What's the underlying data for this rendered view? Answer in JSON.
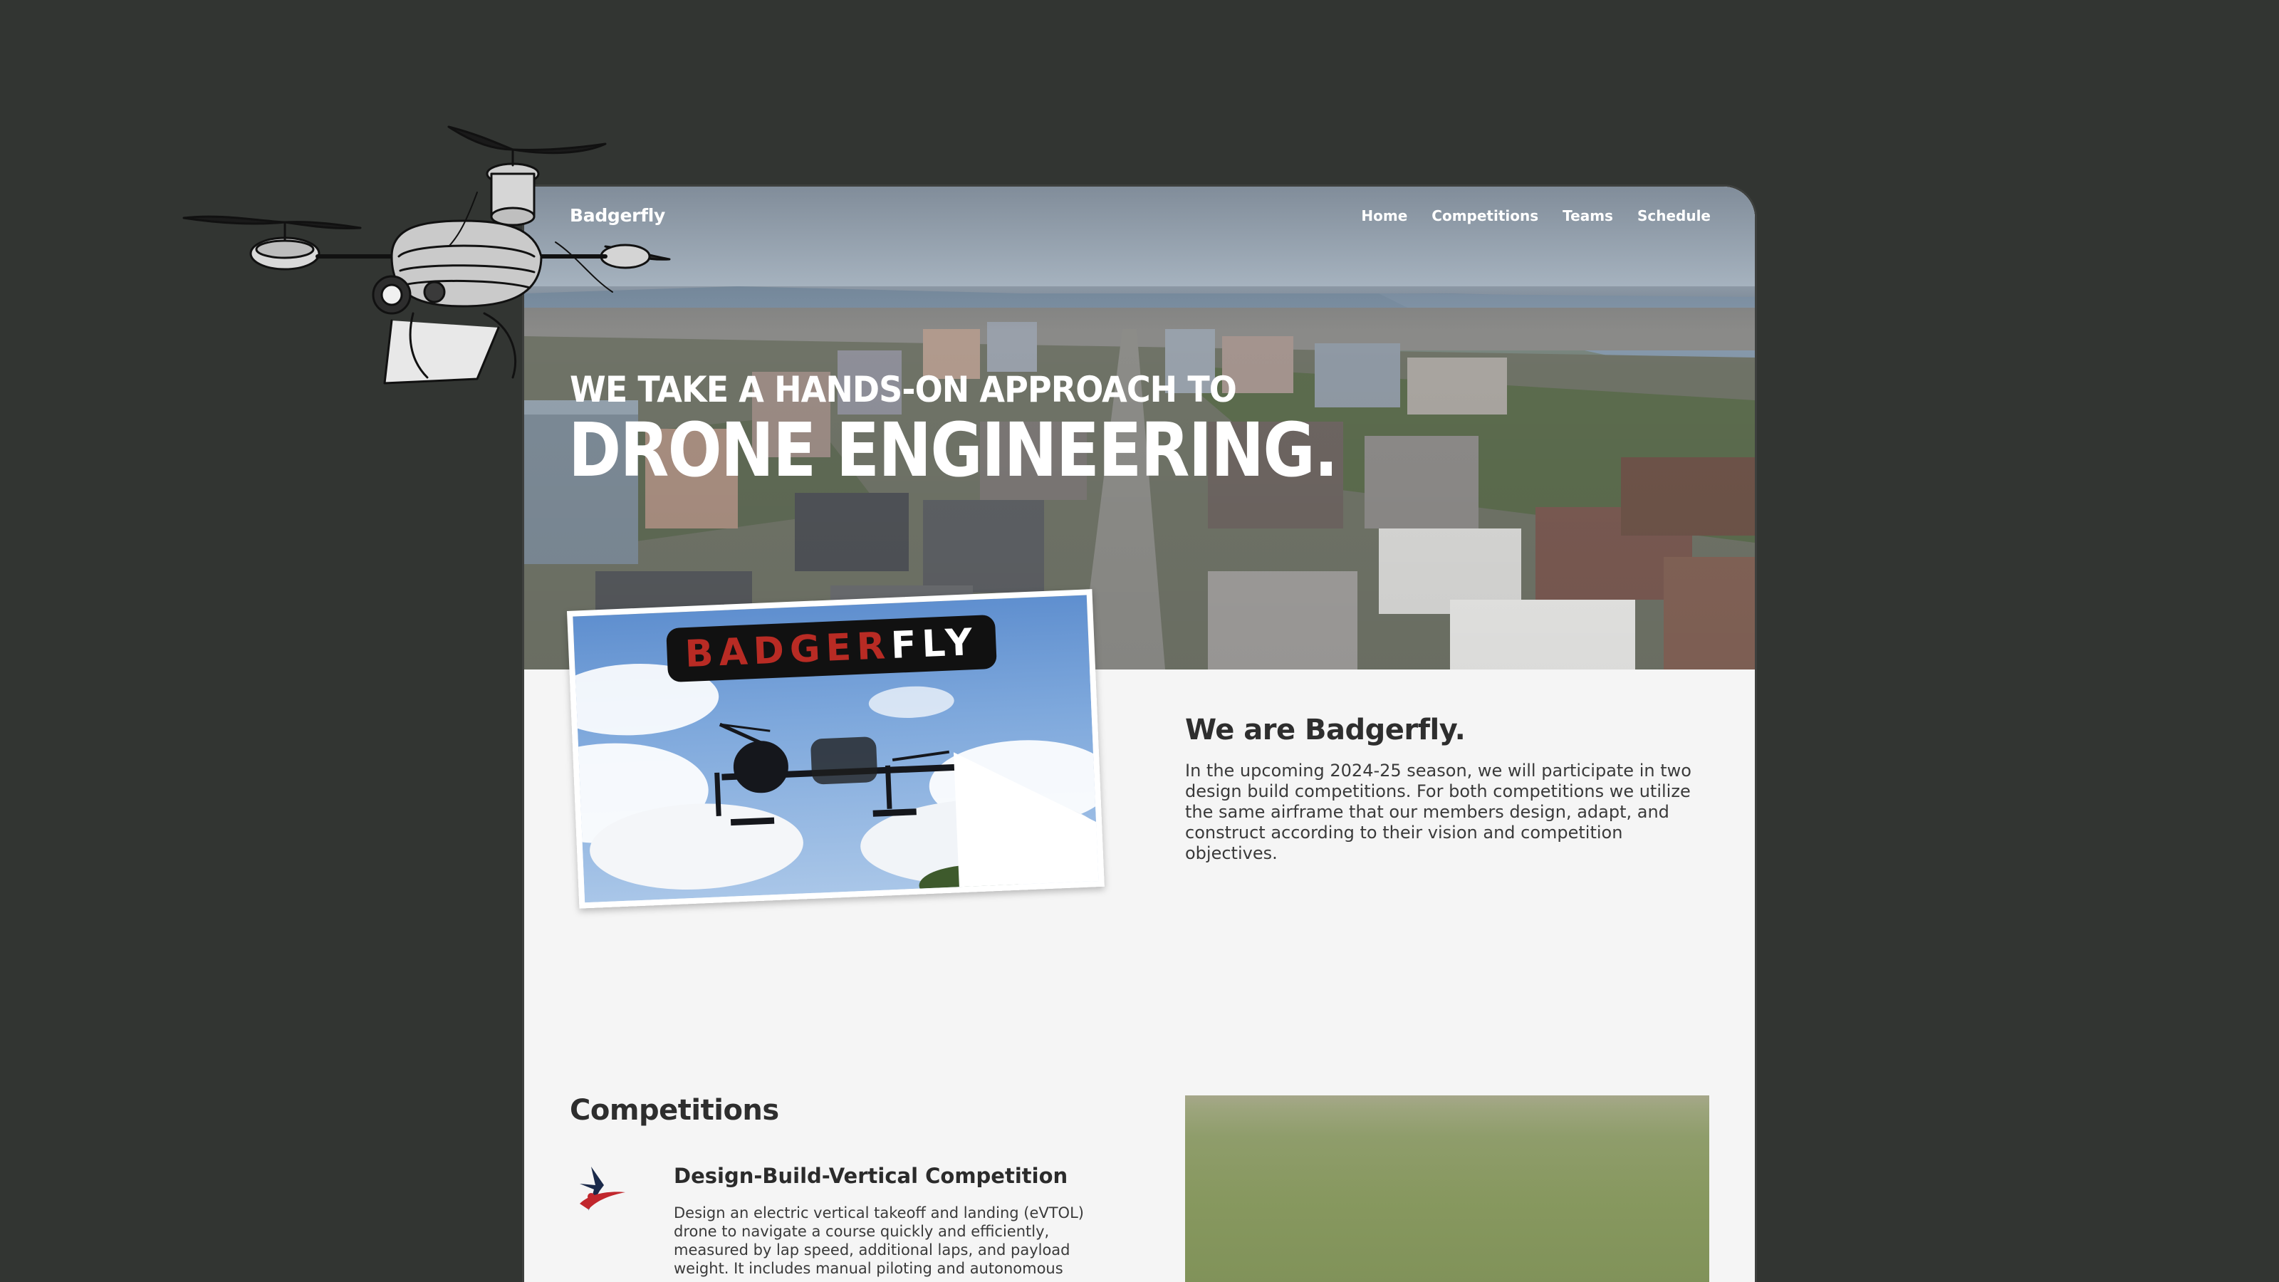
{
  "nav": {
    "brand": "Badgerfly",
    "links": [
      "Home",
      "Competitions",
      "Teams",
      "Schedule"
    ]
  },
  "hero": {
    "line1": "WE TAKE A HANDS-ON APPROACH TO",
    "line2": "DRONE ENGINEERING."
  },
  "video": {
    "logo_red": "BADGER",
    "logo_white": "FLY"
  },
  "about": {
    "title": "We are Badgerfly.",
    "text": "In the upcoming 2024-25 season, we will participate in two design build competitions. For both competitions we utilize the same airframe that our members design, adapt, and construct according to their vision and competition objectives."
  },
  "competitions": {
    "title": "Competitions",
    "items": [
      {
        "name": "Design-Build-Vertical Competition",
        "description": "Design an electric vertical takeoff and landing (eVTOL) drone to navigate a course quickly and efficiently, measured by lap speed, additional laps, and payload weight. It includes manual piloting and autonomous"
      }
    ]
  },
  "colors": {
    "background": "#323532",
    "page": "#f5f5f5",
    "text_dark": "#2e2e2e",
    "logo_red": "#b82b24"
  },
  "icons": [
    "drone-sketch-icon",
    "play-icon",
    "competition-logo-icon"
  ]
}
